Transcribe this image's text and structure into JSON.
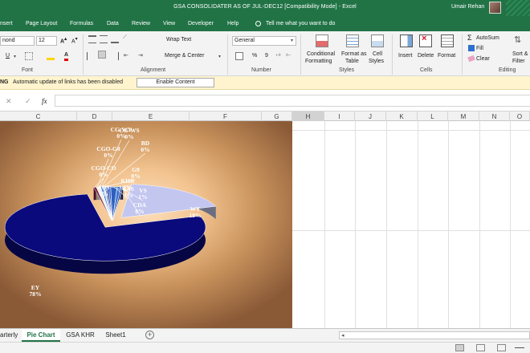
{
  "window": {
    "title": "GSA CONSOLIDATER AS OF JUL-DEC12  [Compatibility Mode]  -  Excel",
    "user": "Umair Rehan"
  },
  "menu": {
    "items": [
      "nsert",
      "Page Layout",
      "Formulas",
      "Data",
      "Review",
      "View",
      "Developer",
      "Help"
    ],
    "tell_me": "Tell me what you want to do"
  },
  "ribbon": {
    "font_name": "nond",
    "font_size": "12",
    "font_group": "Font",
    "wrap_text": "Wrap Text",
    "merge_center": "Merge & Center",
    "alignment_group": "Alignment",
    "number_format": "General",
    "percent": "%",
    "comma": "9",
    "number_group": "Number",
    "conditional_formatting": [
      "Conditional",
      "Formatting"
    ],
    "format_as_table": [
      "Format as",
      "Table"
    ],
    "cell_styles": [
      "Cell",
      "Styles"
    ],
    "styles_group": "Styles",
    "insert": "Insert",
    "delete": "Delete",
    "format": "Format",
    "cells_group": "Cells",
    "autosum": "AutoSum",
    "fill": "Fill",
    "clear": "Clear",
    "sort_filter": [
      "Sort &",
      "Filter"
    ],
    "editing_group": "Editing"
  },
  "message_bar": {
    "label": "NG",
    "message": "Automatic update of links has been disabled",
    "button": "Enable Content"
  },
  "formula_bar": {
    "value": ""
  },
  "columns": [
    "C",
    "D",
    "E",
    "F",
    "G",
    "H",
    "I",
    "J",
    "K",
    "L",
    "M",
    "N",
    "O"
  ],
  "chart_data": {
    "type": "pie",
    "title": "",
    "slices": [
      {
        "label": "EY",
        "percent": "78%",
        "value": 78,
        "color": "#0a0a7c"
      },
      {
        "label": "WY",
        "percent": "18%",
        "value": 18,
        "color": "#c3c6ef"
      },
      {
        "label": "CGO-CO",
        "percent": "0%",
        "value": 0.4,
        "color": "#7b1c4a"
      },
      {
        "label": "CGO-G0",
        "percent": "0%",
        "value": 0.4,
        "color": "#f3f0ce"
      },
      {
        "label": "CG-WY",
        "percent": "0%",
        "value": 0.3,
        "color": "#dfe9f7"
      },
      {
        "label": "CG-WS",
        "percent": "0%",
        "value": 0.3,
        "color": "#2a6ee0"
      },
      {
        "label": "BD",
        "percent": "0%",
        "value": 0.3,
        "color": "#c5e0ef"
      },
      {
        "label": "G9",
        "percent": "0%",
        "value": 0.3,
        "color": "#4c4ca0"
      },
      {
        "label": "AOS",
        "percent": "0%",
        "value": 0.3,
        "color": "#1d3f9a"
      },
      {
        "label": "KHR",
        "percent": "0%",
        "value": 0.3,
        "color": "#1a5bd6"
      },
      {
        "label": "SAS",
        "percent": "1%",
        "value": 1,
        "color": "#2f5fbf"
      },
      {
        "label": "VS",
        "percent": "1%",
        "value": 0.6,
        "color": "#3a73d1"
      },
      {
        "label": "CDA",
        "percent": "0%",
        "value": 0.3,
        "color": "#17338a"
      }
    ]
  },
  "sheet_tabs": [
    {
      "label": "arterly",
      "active": false
    },
    {
      "label": "Pie Chart",
      "active": true
    },
    {
      "label": "GSA KHR",
      "active": false
    },
    {
      "label": "Sheet1",
      "active": false
    }
  ]
}
